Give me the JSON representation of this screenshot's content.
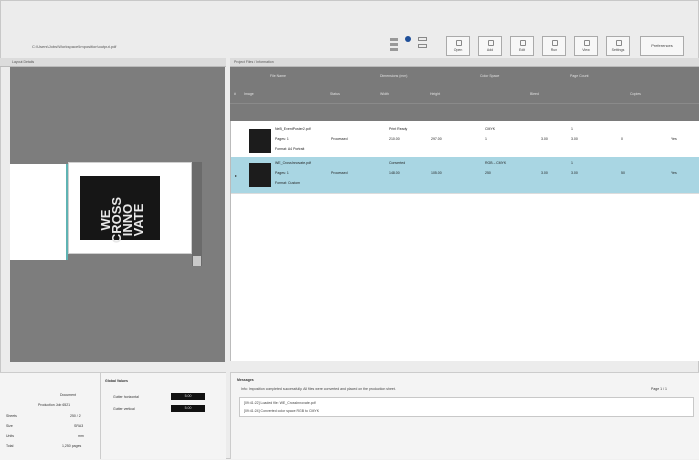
{
  "toolbar": {
    "path": "C:\\Users\\Jobs\\Workspace\\Imposition\\output.pdf",
    "buttons": [
      {
        "label": "Open"
      },
      {
        "label": "Add"
      },
      {
        "label": "Edit"
      },
      {
        "label": "Run"
      },
      {
        "label": "View"
      },
      {
        "label": "Settings"
      }
    ],
    "wide_button": "Preferences"
  },
  "left_pane": {
    "header": "Layout  Details",
    "thumb_text": "WE CROSS INNO VATE"
  },
  "right_pane": {
    "header": "Project Files / Information",
    "columns": [
      "#",
      "Image",
      "File Name",
      "Status",
      "Dimensions (mm)",
      "Bleed",
      "Width",
      "Height",
      "Color Space",
      "Copies",
      "Page Count"
    ],
    "rows": [
      {
        "marker": "",
        "name": "NeB_EventPoster2.pdf",
        "line2": "Pages: 1",
        "line3": "Format: A4 Portrait",
        "status": "Processed",
        "w": "210.00",
        "h": "297.00",
        "cs": "CMYK",
        "copies": "1",
        "pages": "1",
        "c1": "Print Ready",
        "c2": "3.00",
        "c3": "3.00",
        "c4": "0",
        "c5": "Yes"
      },
      {
        "marker": "▸",
        "name": "WE_CrossInnovate.pdf",
        "line2": "Pages: 1",
        "line3": "Format: Custom",
        "status": "Processed",
        "w": "148.00",
        "h": "105.00",
        "cs": "RGB→CMYK",
        "copies": "250",
        "pages": "1",
        "c1": "Converted",
        "c2": "3.00",
        "c3": "3.00",
        "c4": "50",
        "c5": "Yes"
      }
    ]
  },
  "bottom_left": {
    "rows": [
      {
        "k": "",
        "v": "Document"
      },
      {
        "k": "",
        "v": "Production Job 6521"
      },
      {
        "k": "Sheets",
        "v": "250 / 2"
      },
      {
        "k": "Size",
        "v": "SRA3"
      },
      {
        "k": "Units",
        "v": "mm"
      },
      {
        "k": "Total",
        "v": "1,250 pages"
      }
    ]
  },
  "bottom_mid": {
    "title": "Global Values",
    "rows": [
      {
        "k": "Gutter horizontal",
        "v": "5.00"
      },
      {
        "k": "Gutter vertical",
        "v": "5.00"
      }
    ]
  },
  "bottom_right": {
    "title": "Messages",
    "line1": "Info: Imposition completed successfully. All files were converted and placed on the production sheet.",
    "page_info": "Page 1 / 1",
    "log1": "[09:41:22] Loaded file: WE_CrossInnovate.pdf",
    "log2": "[09:41:24] Converted color space RGB to CMYK"
  }
}
